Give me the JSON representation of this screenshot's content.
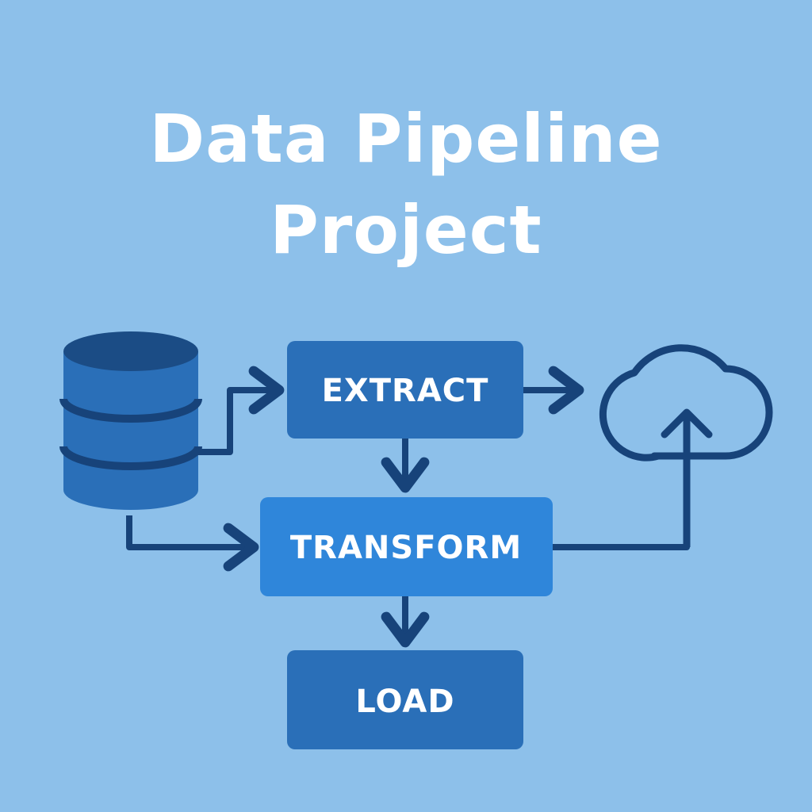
{
  "title": {
    "line1": "Data Pipeline",
    "line2": "Project"
  },
  "stages": {
    "extract": "EXTRACT",
    "transform": "TRANSFORM",
    "load": "LOAD"
  },
  "icons": {
    "source": "database-icon",
    "destination": "cloud-upload-icon"
  },
  "colors": {
    "background": "#8DC0EA",
    "box_dark": "#2A6FB8",
    "box_light": "#2F86DA",
    "line": "#17437A",
    "title": "#FFFFFF"
  }
}
